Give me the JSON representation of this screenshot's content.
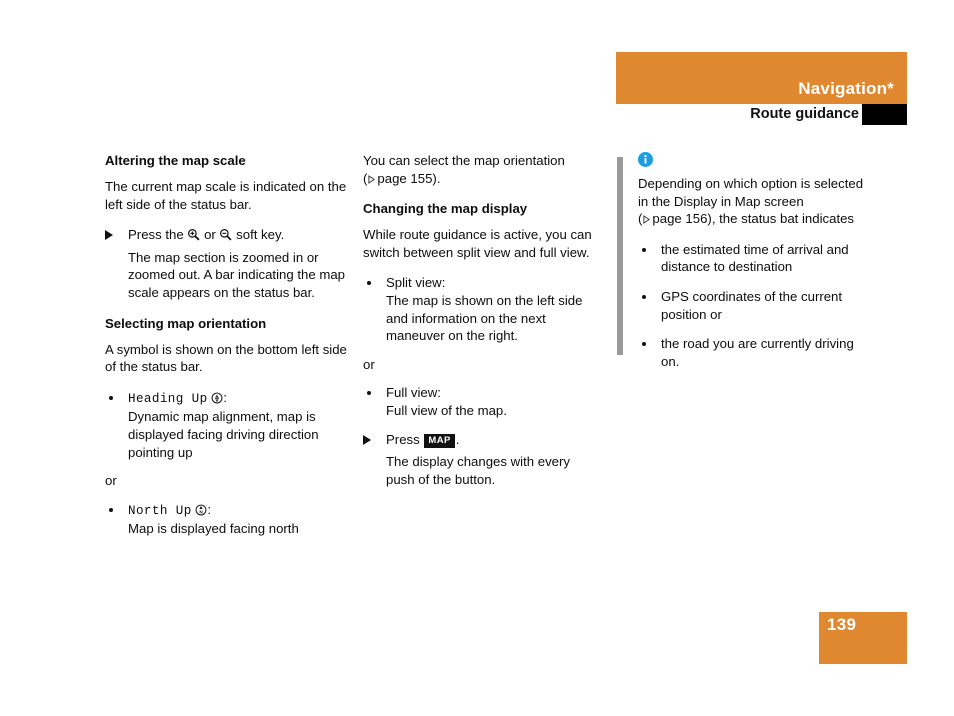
{
  "header": {
    "title": "Navigation*",
    "subtitle": "Route guidance",
    "accent_color": "#df882f",
    "tab_color": "#000000"
  },
  "left_column": {
    "section1_heading": "Altering the map scale",
    "section1_para": "The current map scale is indicated on the left side of the status bar.",
    "step1_before": "Press the",
    "step1_middle": "or",
    "step1_after": "soft key.",
    "step1_icon_zoom_in": "magnifier-plus-icon",
    "step1_icon_zoom_out": "magnifier-minus-icon",
    "step1_result": "The map section is zoomed in or zoomed out. A bar indicating the map scale appears on the status bar.",
    "section2_heading": "Selecting map orientation",
    "section2_para": "A symbol is shown on the bottom left side of the status bar.",
    "bullet1_term": "Heading Up",
    "bullet1_icon": "compass-heading-up-icon",
    "bullet1_colon": ":",
    "bullet1_text": "Dynamic map alignment, map is displayed facing driving direction pointing up",
    "or_label": "or",
    "bullet2_term": "North Up",
    "bullet2_icon": "compass-north-up-icon",
    "bullet2_colon": ":",
    "bullet2_text": "Map is displayed facing north"
  },
  "middle_column": {
    "intro_line1": "You can select the map orientation",
    "xref_open": "(",
    "xref_label": "page 155",
    "xref_close": ").",
    "section_heading": "Changing the map display",
    "section_para": "While route guidance is active, you can switch between split view and full view.",
    "bullet1_term": "Split view:",
    "bullet1_text": "The map is shown on the left side and information on the next maneuver on the right.",
    "or_label": "or",
    "bullet2_term": "Full view:",
    "bullet2_text": "Full view of the map.",
    "step_before": "Press",
    "step_key": "MAP",
    "step_after": ".",
    "step_result": "The display changes with every push of the button."
  },
  "note": {
    "icon": "info-icon",
    "icon_color": "#1a9ee0",
    "line1": "Depending on which option is selected",
    "line2": "in the Display in Map screen",
    "xref_open": "(",
    "xref_label": "page 156",
    "xref_close": "), the status bat indicates",
    "bullets": [
      "the estimated time of arrival and distance to destination",
      "GPS coordinates of the current position or",
      "the road you are currently driving on."
    ]
  },
  "footer": {
    "page_number": "139",
    "accent_color": "#df882f"
  }
}
